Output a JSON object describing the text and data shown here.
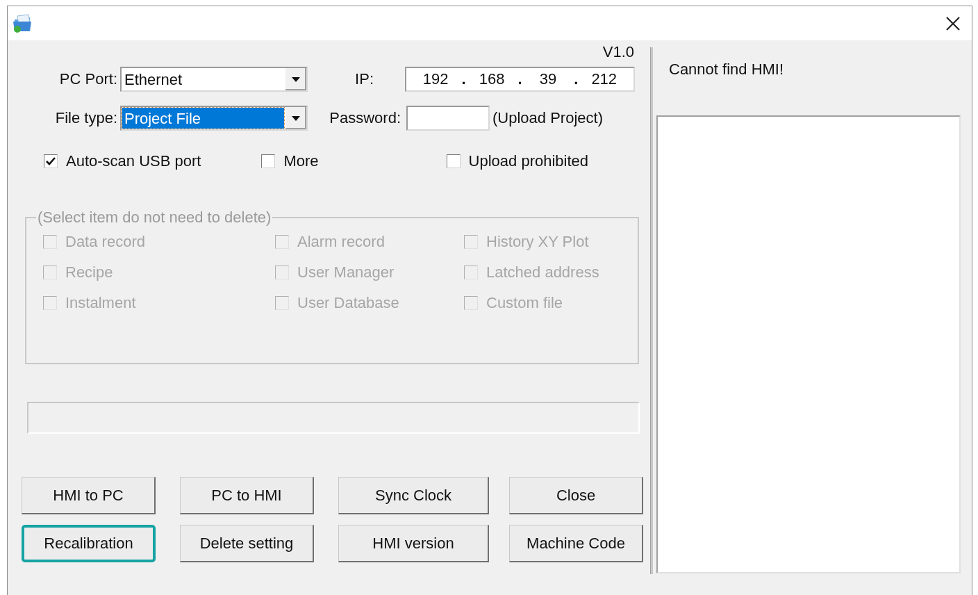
{
  "version": "V1.0",
  "pc_port": {
    "label": "PC Port:",
    "value": "Ethernet",
    "focused": false
  },
  "file_type": {
    "label": "File type:",
    "value": "Project File",
    "focused": true
  },
  "ip": {
    "label": "IP:",
    "parts": [
      {
        "kind": "octet",
        "text": "192"
      },
      {
        "kind": "dot",
        "text": "."
      },
      {
        "kind": "octet",
        "text": "168"
      },
      {
        "kind": "dot",
        "text": "."
      },
      {
        "kind": "octet",
        "text": "39"
      },
      {
        "kind": "dot",
        "text": "."
      },
      {
        "kind": "octet",
        "text": "212"
      }
    ]
  },
  "password": {
    "label": "Password:",
    "note": "(Upload Project)"
  },
  "options": [
    {
      "label": "Auto-scan USB port",
      "checked": true
    },
    {
      "label": "More",
      "checked": false
    },
    {
      "label": "Upload prohibited",
      "checked": false
    }
  ],
  "delete_group": {
    "title": "(Select item do not need to delete)",
    "disabled": true,
    "items": [
      {
        "label": "Data record",
        "checked": false
      },
      {
        "label": "Alarm record",
        "checked": false
      },
      {
        "label": "History XY Plot",
        "checked": false
      },
      {
        "label": "Recipe",
        "checked": false
      },
      {
        "label": "User Manager",
        "checked": false
      },
      {
        "label": "Latched address",
        "checked": false
      },
      {
        "label": "Instalment",
        "checked": false
      },
      {
        "label": "User Database",
        "checked": false
      },
      {
        "label": "Custom file",
        "checked": false
      }
    ]
  },
  "progress": {
    "level": 0
  },
  "buttons": [
    {
      "label": "HMI to PC",
      "focused": false
    },
    {
      "label": "PC to HMI",
      "focused": false
    },
    {
      "label": "Sync Clock",
      "focused": false
    },
    {
      "label": "Close",
      "focused": false
    },
    {
      "label": "Recalibration",
      "focused": true
    },
    {
      "label": "Delete setting",
      "focused": false
    },
    {
      "label": "HMI version",
      "focused": false
    },
    {
      "label": "Machine Code",
      "focused": false
    }
  ],
  "status": "Cannot find HMI!"
}
